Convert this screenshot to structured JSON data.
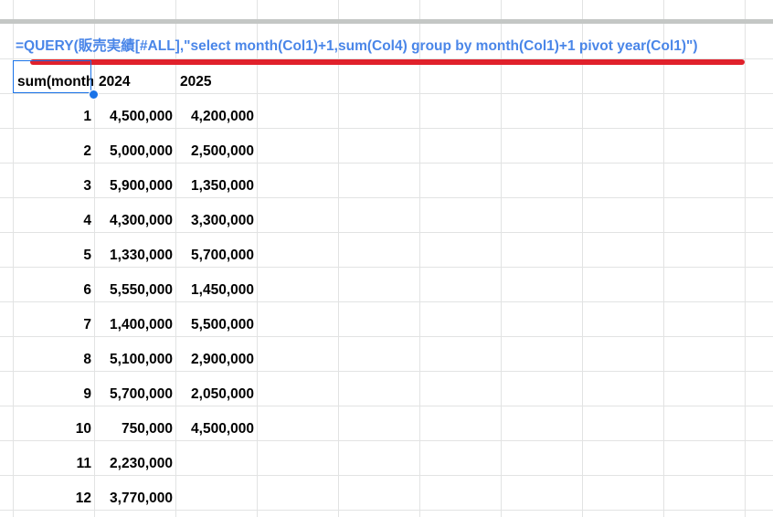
{
  "formula": "=QUERY(販売実績[#ALL],\"select month(Col1)+1,sum(Col4) group by month(Col1)+1 pivot year(Col1)\")",
  "header": {
    "col_a": "sum(month",
    "col_b": "2024",
    "col_c": "2025"
  },
  "rows": [
    {
      "month": "1",
      "y2024": "4,500,000",
      "y2025": "4,200,000"
    },
    {
      "month": "2",
      "y2024": "5,000,000",
      "y2025": "2,500,000"
    },
    {
      "month": "3",
      "y2024": "5,900,000",
      "y2025": "1,350,000"
    },
    {
      "month": "4",
      "y2024": "4,300,000",
      "y2025": "3,300,000"
    },
    {
      "month": "5",
      "y2024": "1,330,000",
      "y2025": "5,700,000"
    },
    {
      "month": "6",
      "y2024": "5,550,000",
      "y2025": "1,450,000"
    },
    {
      "month": "7",
      "y2024": "1,400,000",
      "y2025": "5,500,000"
    },
    {
      "month": "8",
      "y2024": "5,100,000",
      "y2025": "2,900,000"
    },
    {
      "month": "9",
      "y2024": "5,700,000",
      "y2025": "2,050,000"
    },
    {
      "month": "10",
      "y2024": "750,000",
      "y2025": "4,500,000"
    },
    {
      "month": "11",
      "y2024": "2,230,000",
      "y2025": ""
    },
    {
      "month": "12",
      "y2024": "3,770,000",
      "y2025": ""
    }
  ],
  "colors": {
    "formula_text": "#4a86e8",
    "underline": "#e0212b",
    "selection": "#1a73e8",
    "gridline": "#e2e3e3"
  }
}
